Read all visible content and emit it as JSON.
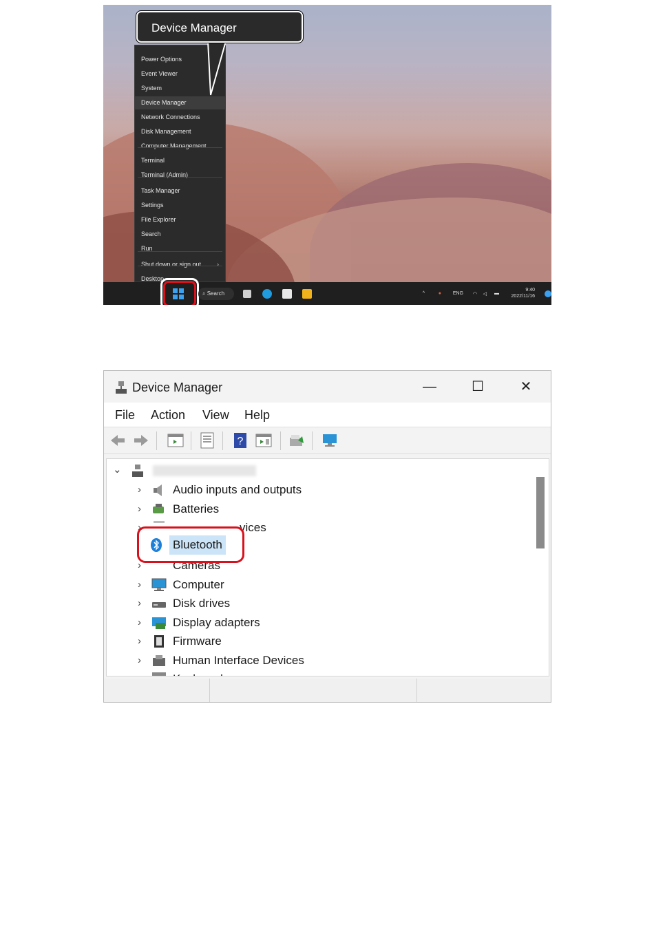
{
  "callout": {
    "label": "Device Manager"
  },
  "winx_menu": {
    "items": [
      "Power Options",
      "Event Viewer",
      "System",
      "Device Manager",
      "Network Connections",
      "Disk Management",
      "Computer Management",
      "Terminal",
      "Terminal (Admin)",
      "Task Manager",
      "Settings",
      "File Explorer",
      "Search",
      "Run",
      "Shut down or sign out",
      "Desktop"
    ],
    "highlighted": "Device Manager",
    "submenu_arrow": "›"
  },
  "taskbar": {
    "search_label": "Search",
    "tray": {
      "lang": "ENG",
      "time": "9:40",
      "date": "2022/11/16"
    }
  },
  "device_manager": {
    "title": "Device Manager",
    "window_controls": {
      "minimize": "—",
      "maximize": "☐",
      "close": "✕"
    },
    "menu": [
      "File",
      "Action",
      "View",
      "Help"
    ],
    "tree": {
      "root_chevron": "⌄",
      "expand_chevron": "›",
      "items": [
        {
          "label": "Audio inputs and outputs",
          "icon": "speaker-icon"
        },
        {
          "label": "Batteries",
          "icon": "battery-icon"
        },
        {
          "label": "vices",
          "icon": "biometric-icon"
        },
        {
          "label": "Bluetooth",
          "icon": "bluetooth-icon",
          "highlighted": true
        },
        {
          "label": "Cameras",
          "icon": "camera-icon"
        },
        {
          "label": "Computer",
          "icon": "computer-icon"
        },
        {
          "label": "Disk drives",
          "icon": "disk-drive-icon"
        },
        {
          "label": "Display adapters",
          "icon": "display-adapter-icon"
        },
        {
          "label": "Firmware",
          "icon": "firmware-icon"
        },
        {
          "label": "Human Interface Devices",
          "icon": "hid-icon"
        },
        {
          "label": "Keyboards",
          "icon": "keyboard-icon"
        }
      ]
    }
  },
  "colors": {
    "highlight_red": "#d8121d",
    "accent_blue": "#3aa0f0",
    "menu_bg": "#2b2b2b"
  }
}
